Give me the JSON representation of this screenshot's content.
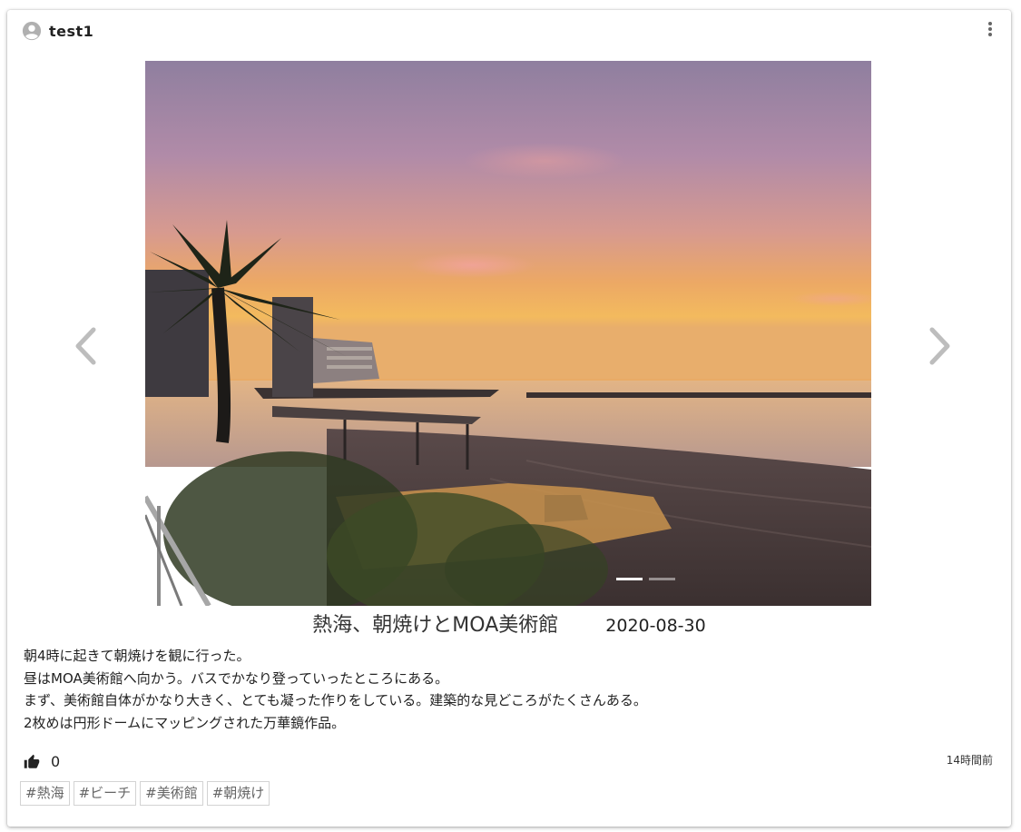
{
  "post": {
    "username": "test1",
    "title": "熱海、朝焼けとMOA美術館",
    "date": "2020-08-30",
    "body": [
      "朝4時に起きて朝焼けを観に行った。",
      "昼はMOA美術館へ向かう。バスでかなり登っていったところにある。",
      "まず、美術館自体がかなり大きく、とても凝った作りをしている。建築的な見どころがたくさんある。",
      "2枚めは円形ドームにマッピングされた万華鏡作品。"
    ],
    "likes": "0",
    "time_ago": "14時間前",
    "tags": [
      "#熱海",
      "#ビーチ",
      "#美術館",
      "#朝焼け"
    ]
  },
  "carousel": {
    "slide_count": 2,
    "active_index": 0
  },
  "icons": {
    "user": "account-circle-icon",
    "more": "more-vertical-icon",
    "prev": "chevron-left-icon",
    "next": "chevron-right-icon",
    "like": "thumb-up-icon"
  },
  "colors": {
    "chevron": "#bdbdbd",
    "tag_border": "#d3d3d3"
  }
}
